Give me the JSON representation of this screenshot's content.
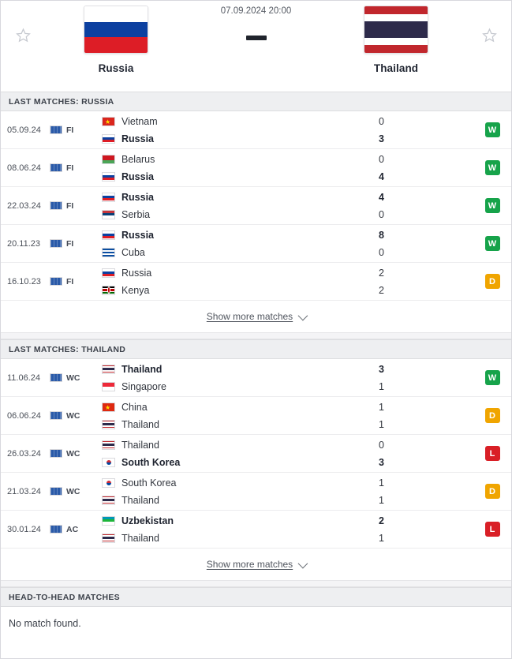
{
  "header": {
    "date": "07.09.2024 20:00",
    "home": {
      "name": "Russia",
      "flag": "russia"
    },
    "away": {
      "name": "Thailand",
      "flag": "thailand"
    },
    "favorite_icon_left": "star-icon",
    "favorite_icon_right": "star-icon"
  },
  "sections": [
    {
      "id": "last-matches-russia",
      "title": "LAST MATCHES: RUSSIA",
      "matches": [
        {
          "date": "05.09.24",
          "comp": "FI",
          "comp_flag": "world",
          "home": {
            "name": "Vietnam",
            "flag": "vietnam",
            "bold": false,
            "score": "0"
          },
          "away": {
            "name": "Russia",
            "flag": "russia",
            "bold": true,
            "score": "3"
          },
          "result": "W"
        },
        {
          "date": "08.06.24",
          "comp": "FI",
          "comp_flag": "world",
          "home": {
            "name": "Belarus",
            "flag": "belarus",
            "bold": false,
            "score": "0"
          },
          "away": {
            "name": "Russia",
            "flag": "russia",
            "bold": true,
            "score": "4"
          },
          "result": "W"
        },
        {
          "date": "22.03.24",
          "comp": "FI",
          "comp_flag": "world",
          "home": {
            "name": "Russia",
            "flag": "russia",
            "bold": true,
            "score": "4"
          },
          "away": {
            "name": "Serbia",
            "flag": "serbia",
            "bold": false,
            "score": "0"
          },
          "result": "W"
        },
        {
          "date": "20.11.23",
          "comp": "FI",
          "comp_flag": "world",
          "home": {
            "name": "Russia",
            "flag": "russia",
            "bold": true,
            "score": "8"
          },
          "away": {
            "name": "Cuba",
            "flag": "cuba",
            "bold": false,
            "score": "0"
          },
          "result": "W"
        },
        {
          "date": "16.10.23",
          "comp": "FI",
          "comp_flag": "world",
          "home": {
            "name": "Russia",
            "flag": "russia",
            "bold": false,
            "score": "2"
          },
          "away": {
            "name": "Kenya",
            "flag": "kenya",
            "bold": false,
            "score": "2"
          },
          "result": "D"
        }
      ],
      "show_more": "Show more matches"
    },
    {
      "id": "last-matches-thailand",
      "title": "LAST MATCHES: THAILAND",
      "matches": [
        {
          "date": "11.06.24",
          "comp": "WC",
          "comp_flag": "world",
          "home": {
            "name": "Thailand",
            "flag": "thailand",
            "bold": true,
            "score": "3"
          },
          "away": {
            "name": "Singapore",
            "flag": "singapore",
            "bold": false,
            "score": "1"
          },
          "result": "W"
        },
        {
          "date": "06.06.24",
          "comp": "WC",
          "comp_flag": "world",
          "home": {
            "name": "China",
            "flag": "china",
            "bold": false,
            "score": "1"
          },
          "away": {
            "name": "Thailand",
            "flag": "thailand",
            "bold": false,
            "score": "1"
          },
          "result": "D"
        },
        {
          "date": "26.03.24",
          "comp": "WC",
          "comp_flag": "world",
          "home": {
            "name": "Thailand",
            "flag": "thailand",
            "bold": false,
            "score": "0"
          },
          "away": {
            "name": "South Korea",
            "flag": "southkorea",
            "bold": true,
            "score": "3"
          },
          "result": "L"
        },
        {
          "date": "21.03.24",
          "comp": "WC",
          "comp_flag": "world",
          "home": {
            "name": "South Korea",
            "flag": "southkorea",
            "bold": false,
            "score": "1"
          },
          "away": {
            "name": "Thailand",
            "flag": "thailand",
            "bold": false,
            "score": "1"
          },
          "result": "D"
        },
        {
          "date": "30.01.24",
          "comp": "AC",
          "comp_flag": "world",
          "home": {
            "name": "Uzbekistan",
            "flag": "uzbekistan",
            "bold": true,
            "score": "2"
          },
          "away": {
            "name": "Thailand",
            "flag": "thailand",
            "bold": false,
            "score": "1"
          },
          "result": "L"
        }
      ],
      "show_more": "Show more matches"
    }
  ],
  "h2h": {
    "title": "HEAD-TO-HEAD MATCHES",
    "empty_text": "No match found."
  },
  "colors": {
    "win": "#16a34a",
    "draw": "#f0a500",
    "loss": "#d91f26",
    "section_bg": "#eeeff1"
  }
}
